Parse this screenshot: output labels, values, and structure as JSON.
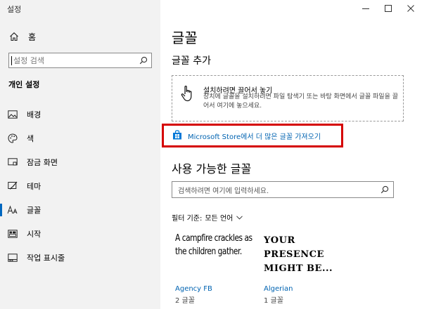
{
  "window": {
    "title": "설정"
  },
  "sidebar": {
    "home_label": "홈",
    "search_placeholder": "설정 검색",
    "section_title": "개인 설정",
    "items": [
      {
        "label": "배경",
        "icon": "picture-icon"
      },
      {
        "label": "색",
        "icon": "palette-icon"
      },
      {
        "label": "잠금 화면",
        "icon": "lock-screen-icon"
      },
      {
        "label": "테마",
        "icon": "brush-icon"
      },
      {
        "label": "글꼴",
        "icon": "font-icon",
        "active": true
      },
      {
        "label": "시작",
        "icon": "start-icon"
      },
      {
        "label": "작업 표시줄",
        "icon": "taskbar-icon"
      }
    ]
  },
  "main": {
    "title": "글꼴",
    "add_section_title": "글꼴 추가",
    "drop_zone": {
      "title": "설치하려면 끌어서 놓기",
      "description": "장치에 글꼴을 설치하려면 파일 탐색기 또는 바탕 화면에서 글꼴 파일을 끌어서 여기에 놓으세요."
    },
    "store_link": "Microsoft Store에서 더 많은 글꼴 가져오기",
    "available_title": "사용 가능한 글꼴",
    "search_placeholder": "검색하려면 여기에 입력하세요.",
    "filter_label": "필터 기준:",
    "filter_value": "모든 언어",
    "fonts": [
      {
        "preview": "A campfire crackles as the children gather.",
        "name": "Agency FB",
        "count": "2 글꼴"
      },
      {
        "preview": "YOUR PRESENCE MIGHT BE...",
        "name": "Algerian",
        "count": "1 글꼴"
      }
    ]
  },
  "colors": {
    "accent": "#0067c0",
    "link": "#0063b1",
    "highlight_border": "#d50000",
    "sidebar_bg": "#f2f2f2"
  }
}
